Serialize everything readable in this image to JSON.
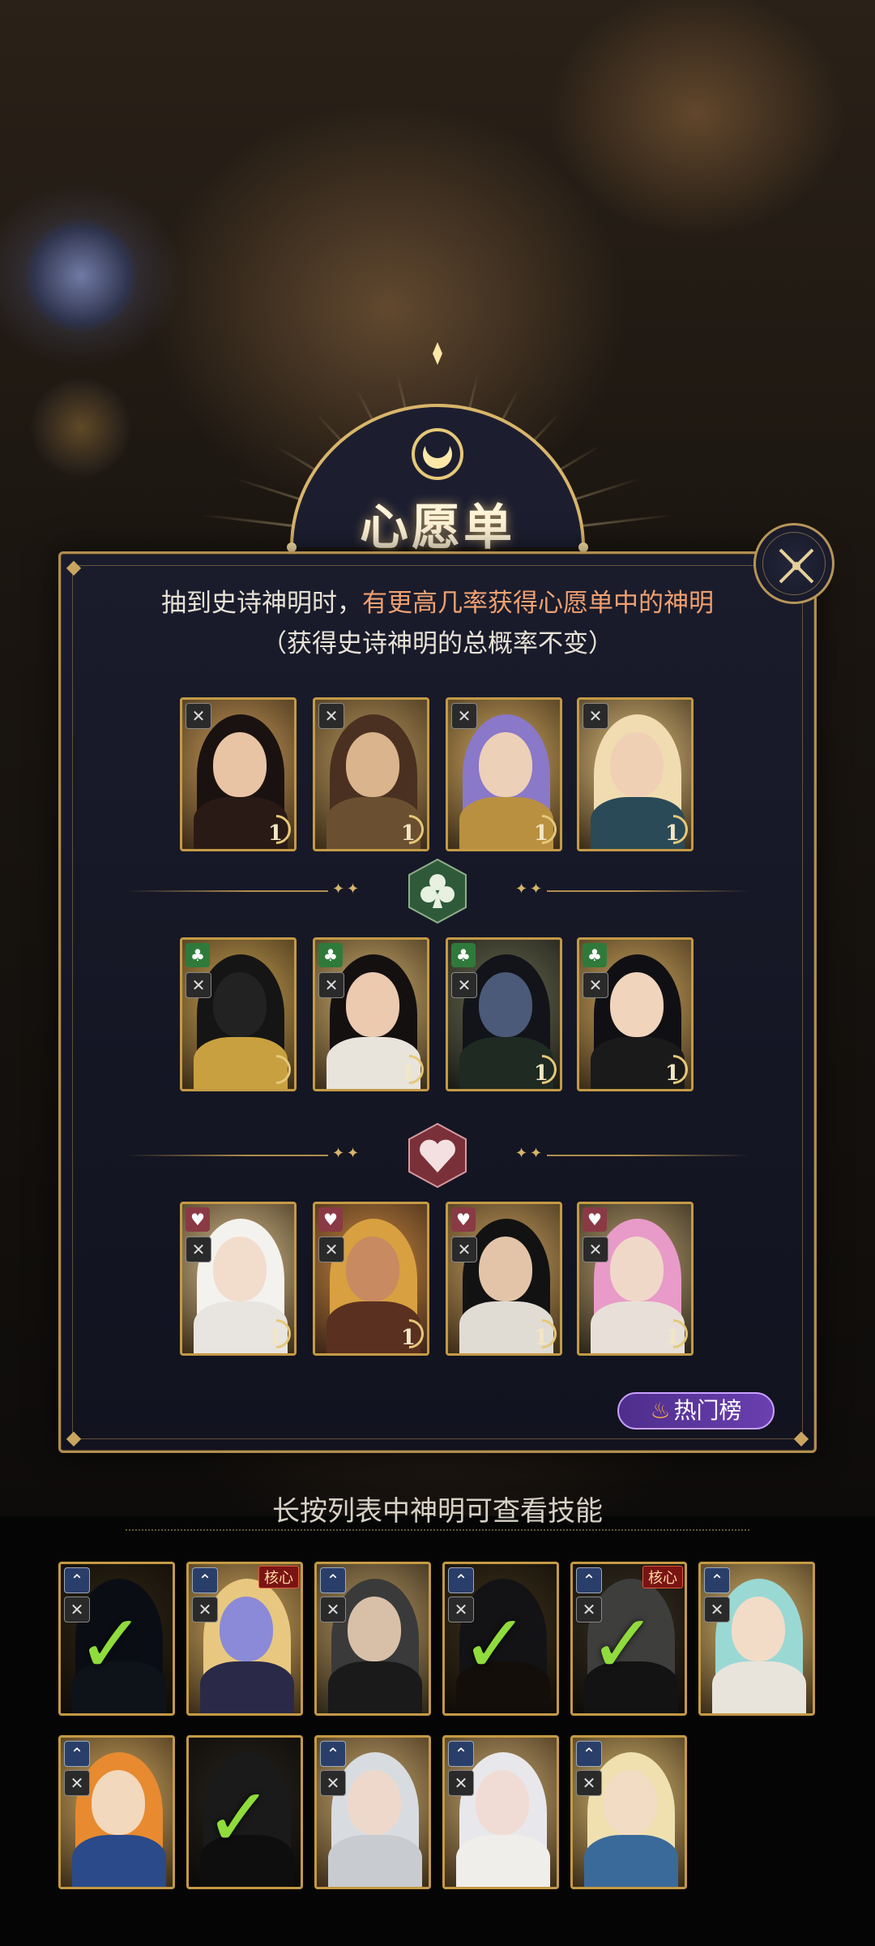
{
  "header": {
    "title": "心愿单"
  },
  "description": {
    "line1_prefix": "抽到史诗神明时，",
    "line1_highlight": "有更高几率获得心愿单中的神明",
    "line2": "（获得史诗神明的总概率不变）"
  },
  "wishlist": {
    "top_row": [
      {
        "name": "card-1",
        "count": "1"
      },
      {
        "name": "card-2",
        "count": "1"
      },
      {
        "name": "card-3",
        "count": "1"
      },
      {
        "name": "card-4",
        "count": "1"
      }
    ],
    "club_row": [
      {
        "count": "1"
      },
      {
        "count": "1"
      },
      {
        "count": "1"
      },
      {
        "count": "1"
      }
    ],
    "heart_row": [
      {
        "count": "1"
      },
      {
        "count": "1"
      },
      {
        "count": "1"
      },
      {
        "count": "1"
      }
    ]
  },
  "hot_button": {
    "label": "热门榜"
  },
  "hint": {
    "text": "长按列表中神明可查看技能"
  },
  "list": {
    "core_label": "核心"
  },
  "colors": {
    "accent_gold": "#b08d4f",
    "highlight": "#f0a070",
    "check": "#8fdc3c",
    "hot_purple": "#6a3fb0"
  },
  "icons": [
    "close-icon",
    "club-icon",
    "heart-icon",
    "flame-icon",
    "checkmark-icon",
    "moon-icon"
  ]
}
